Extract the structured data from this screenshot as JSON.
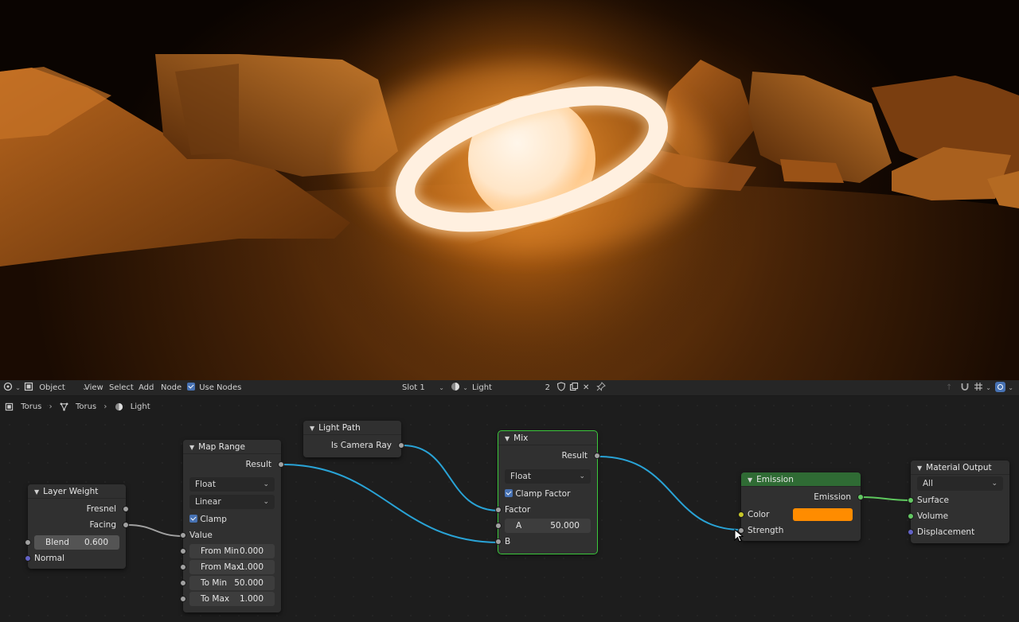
{
  "header": {
    "editor_type": "Object",
    "menu": [
      "View",
      "Select",
      "Add",
      "Node"
    ],
    "use_nodes_label": "Use Nodes",
    "slot": "Slot 1",
    "material": "Light",
    "users": "2"
  },
  "breadcrumb": [
    "Torus",
    "Torus",
    "Light"
  ],
  "nodes": {
    "layer_weight": {
      "title": "Layer Weight",
      "out_fresnel": "Fresnel",
      "out_facing": "Facing",
      "blend_label": "Blend",
      "blend_value": "0.600",
      "in_normal": "Normal"
    },
    "map_range": {
      "title": "Map Range",
      "out_result": "Result",
      "data_type": "Float",
      "interp": "Linear",
      "clamp_label": "Clamp",
      "in_value": "Value",
      "from_min_label": "From Min",
      "from_min": "0.000",
      "from_max_label": "From Max",
      "from_max": "1.000",
      "to_min_label": "To Min",
      "to_min": "50.000",
      "to_max_label": "To Max",
      "to_max": "1.000"
    },
    "light_path": {
      "title": "Light Path",
      "out_camera_ray": "Is Camera Ray"
    },
    "mix": {
      "title": "Mix",
      "out_result": "Result",
      "data_type": "Float",
      "clamp_label": "Clamp Factor",
      "in_factor": "Factor",
      "a_label": "A",
      "a_value": "50.000",
      "in_b": "B"
    },
    "emission": {
      "title": "Emission",
      "out_emission": "Emission",
      "in_color": "Color",
      "color": "#ff8c00",
      "in_strength": "Strength"
    },
    "material_output": {
      "title": "Material Output",
      "target": "All",
      "in_surface": "Surface",
      "in_volume": "Volume",
      "in_displacement": "Displacement"
    }
  },
  "colors": {
    "wire_float": "#29a3d6",
    "wire_gray": "#a1a1a1",
    "wire_green": "#5ec85e",
    "emission_header": "#2f6b34",
    "select_outline": "#3cc83c",
    "accent": "#4772b3"
  }
}
